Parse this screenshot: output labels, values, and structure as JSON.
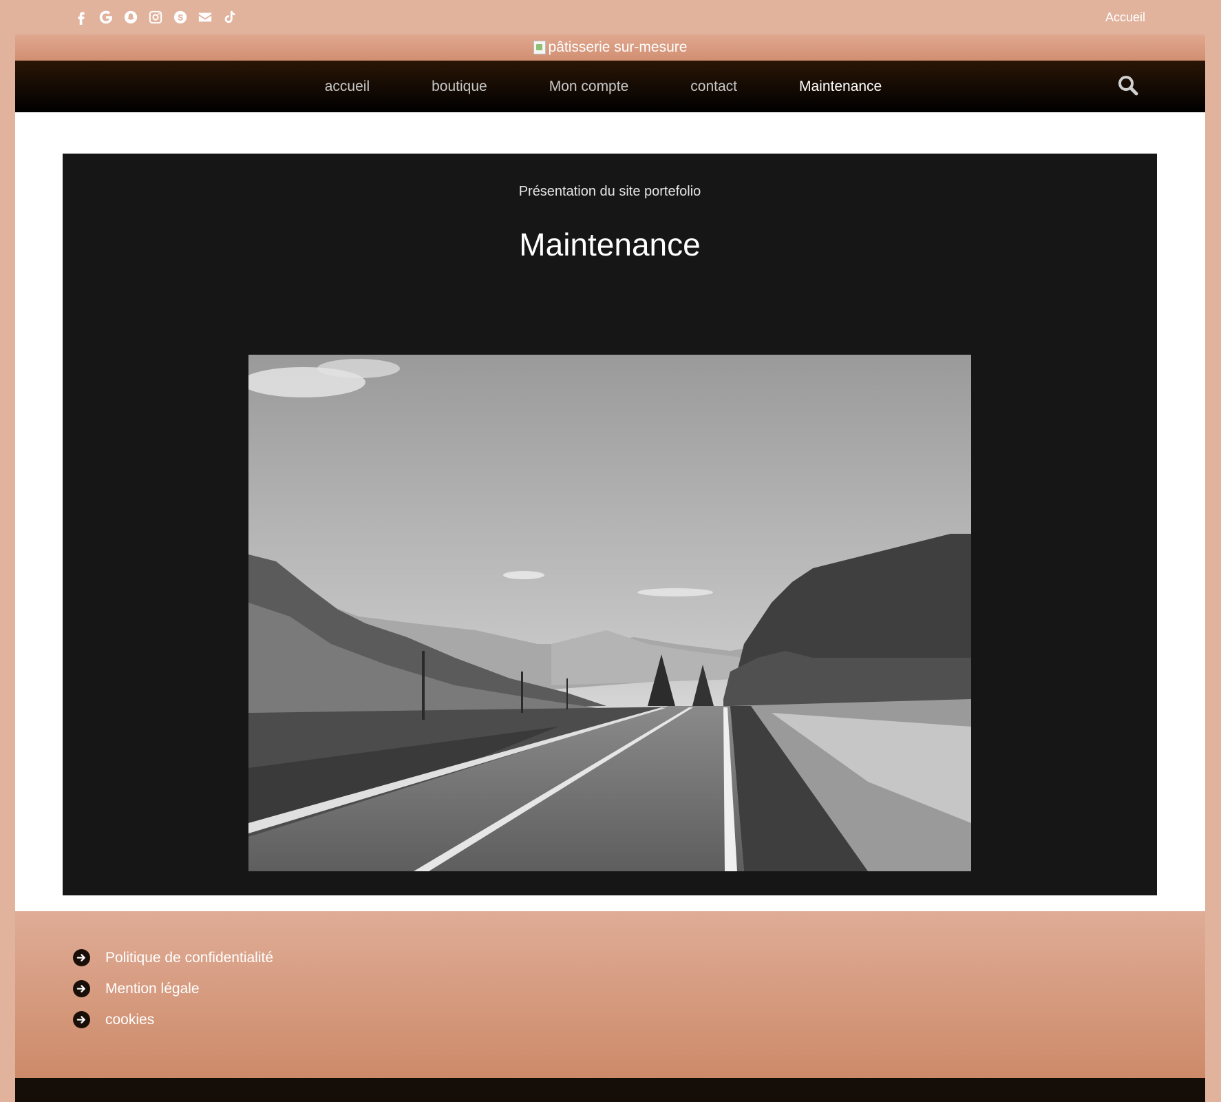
{
  "topbar": {
    "social_icons": [
      "facebook-icon",
      "google-icon",
      "snapchat-icon",
      "instagram-icon",
      "skype-icon",
      "envelope-icon",
      "tiktok-icon"
    ],
    "link": "Accueil"
  },
  "header": {
    "logo_alt": "pâtisserie sur-mesure"
  },
  "nav": {
    "items": [
      {
        "label": "accueil"
      },
      {
        "label": "boutique"
      },
      {
        "label": "Mon compte"
      },
      {
        "label": "contact"
      },
      {
        "label": "Maintenance"
      }
    ],
    "active": "Maintenance",
    "search_icon": "search-icon"
  },
  "main": {
    "subtitle": "Présentation du site portefolio",
    "title": "Maintenance"
  },
  "footer": {
    "links": [
      {
        "label": "Politique de confidentialité"
      },
      {
        "label": "Mention légale"
      },
      {
        "label": "cookies"
      }
    ]
  },
  "colors": {
    "background": "#e1b29c",
    "nav_bg": "#1a0d03",
    "panel_bg": "#161616",
    "footer_top": "#dfac96",
    "footer_bottom": "#cd8a69"
  }
}
